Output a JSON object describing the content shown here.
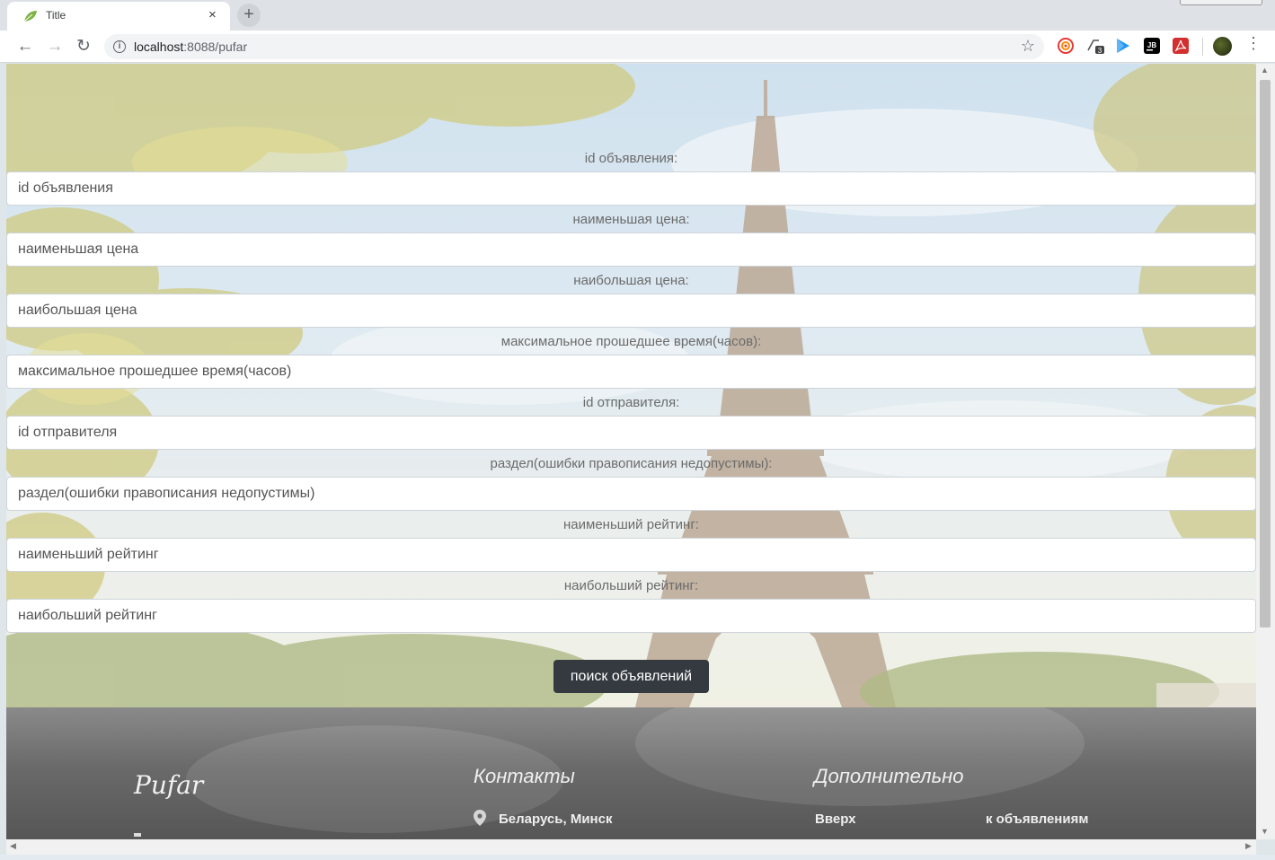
{
  "browser": {
    "tab_title": "Title",
    "tab_close": "×",
    "new_tab": "+",
    "url_host": "localhost",
    "url_rest": ":8088/pufar",
    "back": "←",
    "forward": "→",
    "reload": "↻",
    "star": "☆",
    "menu": "⋮",
    "extension_badge": "3",
    "extension_jb": "JB"
  },
  "form": {
    "fields": [
      {
        "label": "id объявления:",
        "placeholder": "id объявления"
      },
      {
        "label": "наименьшая цена:",
        "placeholder": "наименьшая цена"
      },
      {
        "label": "наибольшая цена:",
        "placeholder": "наибольшая цена"
      },
      {
        "label": "максимальное прошедшее время(часов):",
        "placeholder": "максимальное прошедшее время(часов)"
      },
      {
        "label": "id отправителя:",
        "placeholder": "id отправителя"
      },
      {
        "label": "раздел(ошибки правописания недопустимы):",
        "placeholder": "раздел(ошибки правописания недопустимы)"
      },
      {
        "label": "наименьший рейтинг:",
        "placeholder": "наименьший рейтинг"
      },
      {
        "label": "наибольший рейтинг:",
        "placeholder": "наибольший рейтинг"
      }
    ],
    "search_button": "поиск объявлений"
  },
  "footer": {
    "brand": "Pufar",
    "contacts_title": "Контакты",
    "contacts_location": "Беларусь, Минск",
    "extra_title": "Дополнительно",
    "link_up": "Вверх",
    "link_ads": "к объявлениям"
  },
  "colors": {
    "button_bg": "#343a40",
    "footer_bg": "#5f5f5f"
  },
  "icons": [
    "leaf-favicon-icon",
    "info-icon",
    "star-icon",
    "location-pin-icon",
    "menu-icon"
  ]
}
